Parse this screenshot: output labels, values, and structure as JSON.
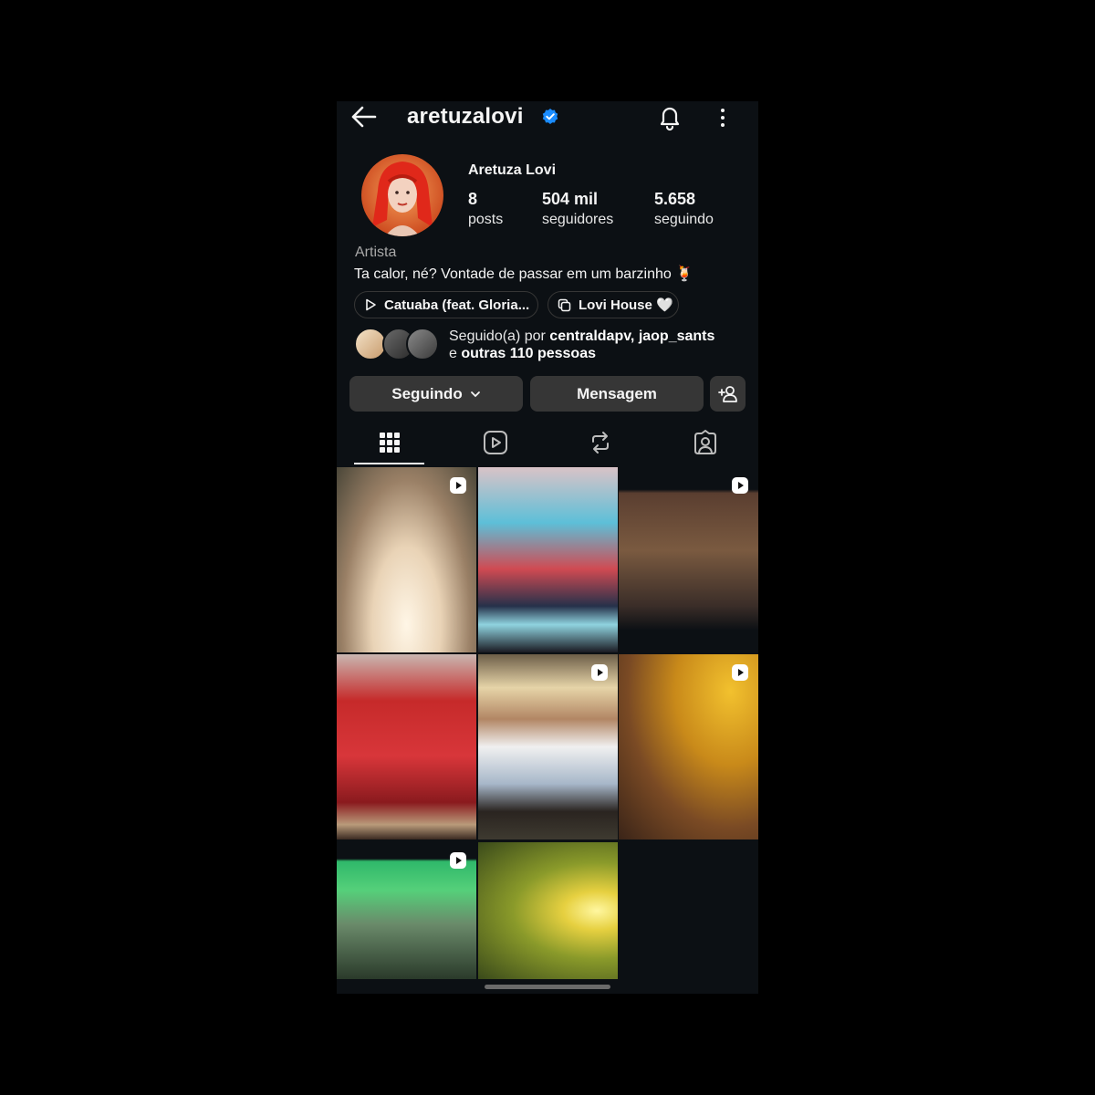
{
  "header": {
    "username": "aretuzalovi",
    "back_icon": "arrow-left-icon",
    "verified_icon": "verified-badge-icon",
    "bell_icon": "bell-icon",
    "more_icon": "more-vertical-icon"
  },
  "profile": {
    "display_name": "Aretuza Lovi",
    "stats": [
      {
        "value": "8",
        "label": "posts"
      },
      {
        "value": "504 mil",
        "label": "seguidores"
      },
      {
        "value": "5.658",
        "label": "seguindo"
      }
    ],
    "category": "Artista",
    "bio": "Ta calor, né? Vontade de passar em um barzinho 🍹"
  },
  "links": [
    {
      "label": "Catuaba (feat. Gloria...",
      "icon": "play-icon"
    },
    {
      "label": "Lovi House 🤍",
      "icon": "threads-icon"
    }
  ],
  "followed_by": {
    "prefix": "Seguido(a) por ",
    "names": "centraldapv, jaop_sants",
    "middle": "e ",
    "others": "outras 110 pessoas"
  },
  "actions": {
    "following_label": "Seguindo",
    "message_label": "Mensagem",
    "add_user_icon": "add-user-icon"
  },
  "tabs": [
    {
      "name": "grid",
      "icon": "grid-icon",
      "active": true
    },
    {
      "name": "reels",
      "icon": "reels-icon",
      "active": false
    },
    {
      "name": "reposts",
      "icon": "repost-icon",
      "active": false
    },
    {
      "name": "tagged",
      "icon": "tagged-icon",
      "active": false
    }
  ],
  "posts": [
    {
      "reel": true
    },
    {
      "reel": false
    },
    {
      "reel": true
    },
    {
      "reel": false
    },
    {
      "reel": true
    },
    {
      "reel": true
    },
    {
      "reel": true
    },
    {
      "reel": false
    }
  ]
}
